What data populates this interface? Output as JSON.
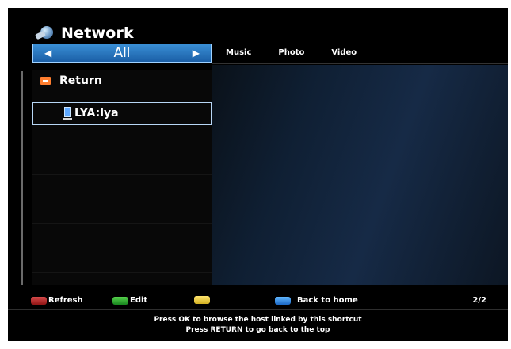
{
  "header": {
    "title": "Network",
    "logo_icon": "network-logo-icon"
  },
  "category_selector": {
    "current": "All",
    "left_arrow": "◀",
    "right_arrow": "▶"
  },
  "tabs": [
    {
      "label": "Music"
    },
    {
      "label": "Photo"
    },
    {
      "label": "Video"
    }
  ],
  "list": {
    "items": [
      {
        "label": "Return",
        "icon": "return-icon"
      },
      {
        "label": "LYA:lya",
        "icon": "host-icon",
        "selected": true
      }
    ]
  },
  "footer": {
    "buttons": [
      {
        "label": "Refresh",
        "color": "#c93a3a"
      },
      {
        "label": "Edit",
        "color": "#39bc33"
      },
      {
        "label": "",
        "color": "#e2c23a"
      },
      {
        "label": "Back to home",
        "color": "#3c8ee7"
      }
    ],
    "page_info": "2/2"
  },
  "hints": [
    "Press OK to browse the host linked by this shortcut",
    "Press RETURN to go back to the top"
  ]
}
